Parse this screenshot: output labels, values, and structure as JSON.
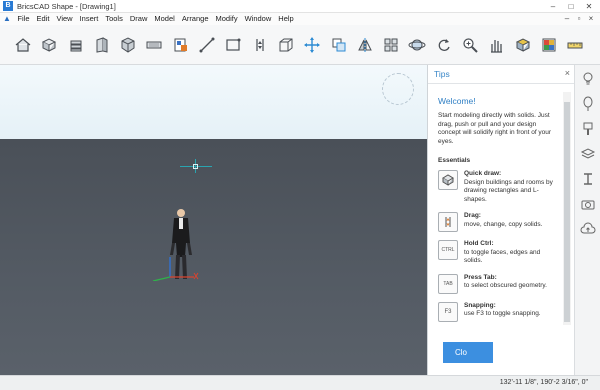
{
  "window": {
    "title": "BricsCAD Shape - [Drawing1]",
    "controls": [
      "–",
      "□",
      "✕"
    ]
  },
  "menu": {
    "items": [
      "File",
      "Edit",
      "View",
      "Insert",
      "Tools",
      "Draw",
      "Model",
      "Arrange",
      "Modify",
      "Window",
      "Help"
    ],
    "doc_controls": [
      "–",
      "▫",
      "×"
    ]
  },
  "toolbar": {
    "tools": [
      "home-icon",
      "box-stack-icon",
      "layers-icon",
      "wall-icon",
      "cube-icon",
      "slab-icon",
      "material-icon",
      "line-icon",
      "rectangle-icon",
      "push-pull-icon",
      "box-wireframe-icon",
      "move-icon",
      "copy-icon",
      "mirror-icon",
      "grid-icon",
      "orbit-icon",
      "rotate-icon",
      "zoom-icon",
      "pan-icon",
      "render-icon",
      "palette-icon",
      "measure-icon"
    ]
  },
  "tips": {
    "header": "Tips",
    "close": "×",
    "welcome": "Welcome!",
    "intro": "Start modeling directly with solids. Just drag, push or pull and your design concept will solidify right in front of your eyes.",
    "section": "Essentials",
    "items": [
      {
        "icon": "",
        "title": "Quick draw:",
        "text": "Design buildings and rooms by drawing rectangles and L-shapes."
      },
      {
        "icon": "",
        "title": "Drag:",
        "text": "move, change, copy solids."
      },
      {
        "icon": "CTRL",
        "title": "Hold Ctrl:",
        "text": "to toggle faces, edges and solids."
      },
      {
        "icon": "TAB",
        "title": "Press Tab:",
        "text": "to select obscured geometry."
      },
      {
        "icon": "F3",
        "title": "Snapping:",
        "text": "use F3 to toggle snapping."
      }
    ],
    "button": "Clo"
  },
  "status": {
    "coords": "132'-11 1/8\", 190'-2 3/16\", 0\""
  }
}
